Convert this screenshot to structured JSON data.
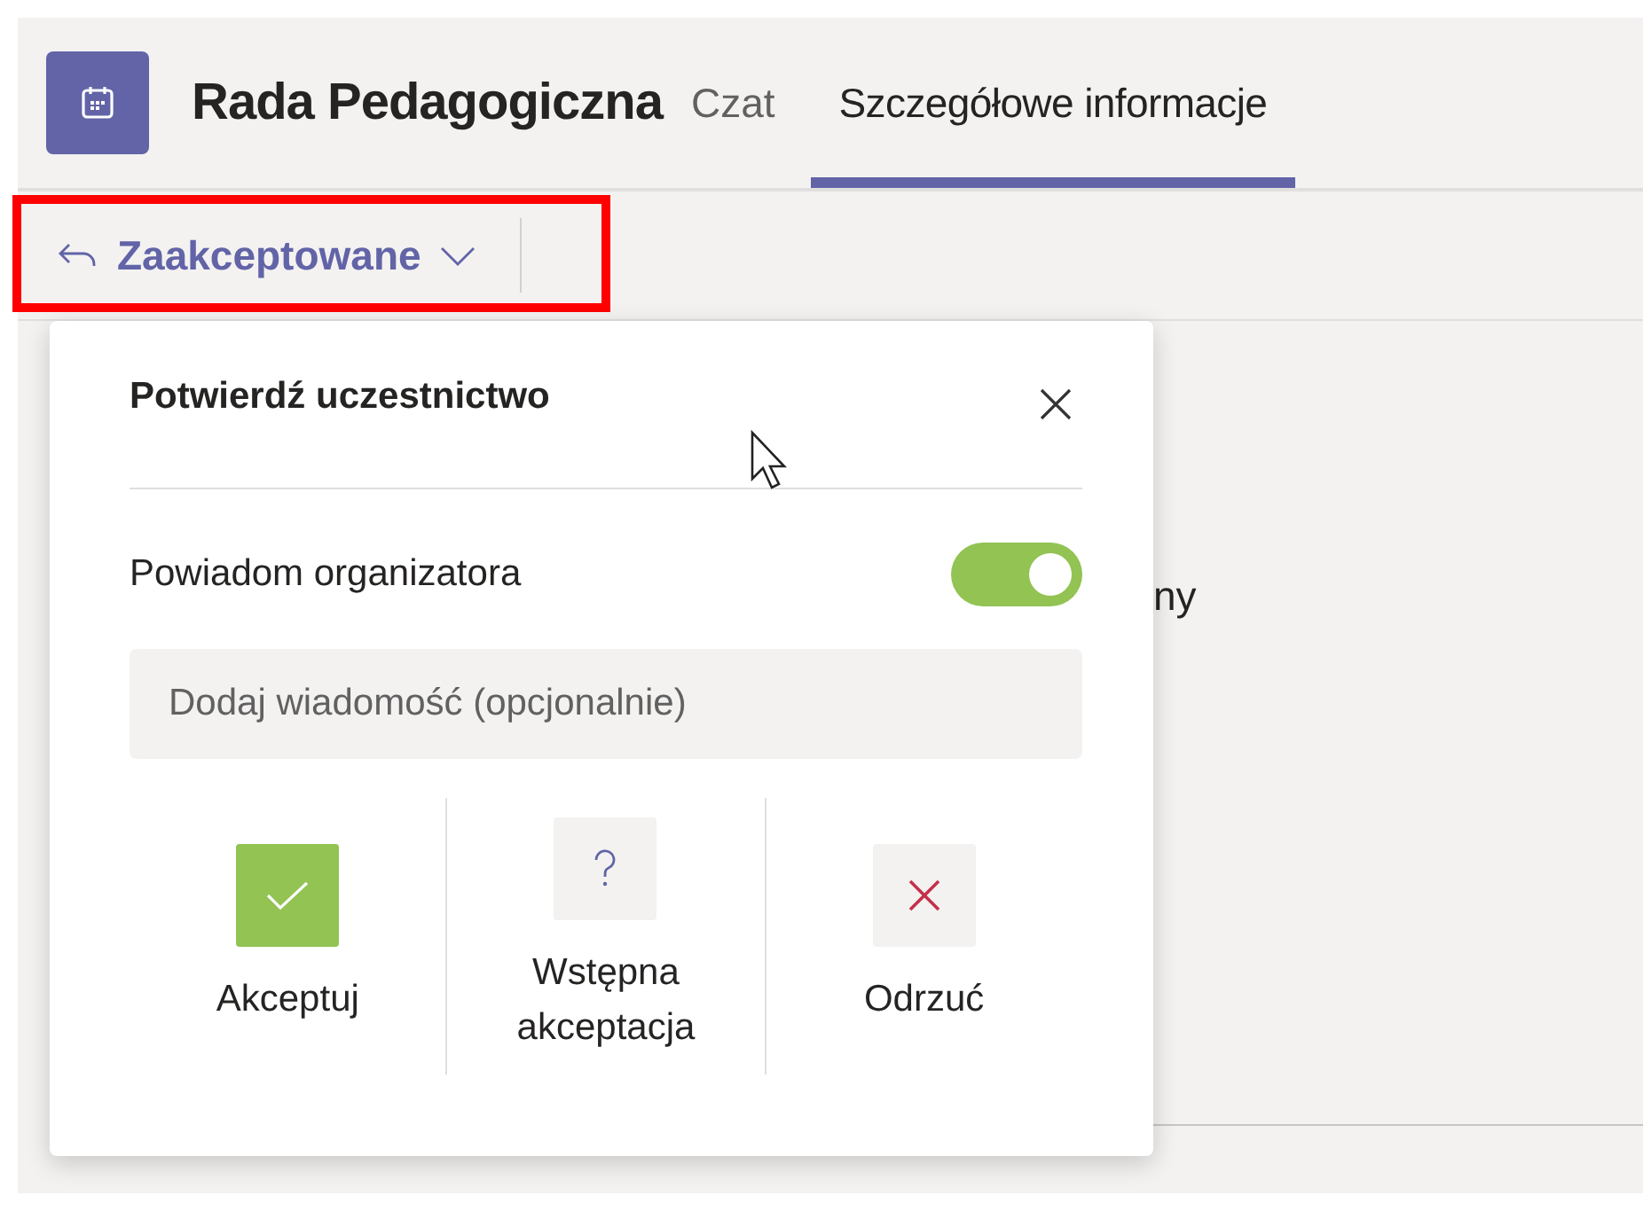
{
  "header": {
    "title": "Rada Pedagogiczna"
  },
  "tabs": [
    {
      "label": "Czat",
      "selected": false
    },
    {
      "label": "Szczegółowe informacje",
      "selected": true
    }
  ],
  "toolbar": {
    "response_button": {
      "label": "Zaakceptowane",
      "highlighted": true
    }
  },
  "background_text": "ny",
  "popup": {
    "title": "Potwierdź uczestnictwo",
    "notify": {
      "label": "Powiadom organizatora",
      "on": true
    },
    "message": {
      "placeholder": "Dodaj wiadomość (opcjonalnie)"
    },
    "options": [
      {
        "kind": "accept",
        "label": "Akceptuj",
        "selected": true
      },
      {
        "kind": "tentative",
        "label": "Wstępna akceptacja",
        "selected": false
      },
      {
        "kind": "decline",
        "label": "Odrzuć",
        "selected": false
      }
    ]
  }
}
